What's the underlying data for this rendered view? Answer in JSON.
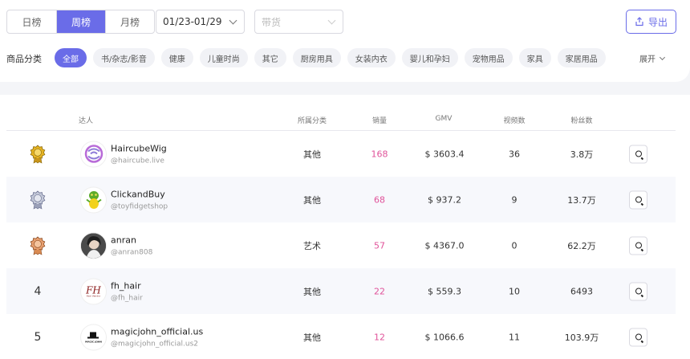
{
  "ranking_tabs": [
    {
      "label": "日榜",
      "active": false
    },
    {
      "label": "周榜",
      "active": true
    },
    {
      "label": "月榜",
      "active": false
    }
  ],
  "date_select": {
    "value": "01/23-01/29"
  },
  "type_select": {
    "placeholder": "带货"
  },
  "export": {
    "label": "导出"
  },
  "category": {
    "label": "商品分类",
    "chips": [
      "全部",
      "书/杂志/影音",
      "健康",
      "儿童时尚",
      "其它",
      "厨房用具",
      "女装内衣",
      "婴儿和孕妇",
      "宠物用品",
      "家具",
      "家居用品"
    ],
    "active": 0,
    "expand_label": "展开"
  },
  "table": {
    "headers": {
      "creator": "达人",
      "category": "所属分类",
      "sales": "销量",
      "gmv": "GMV",
      "videos": "视频数",
      "followers": "粉丝数"
    },
    "rows": [
      {
        "rank": "1",
        "name": "HaircubeWig",
        "handle": "@haircube.live",
        "category": "其他",
        "sales": "168",
        "gmv": "$ 3603.4",
        "videos": "36",
        "followers": "3.8万",
        "avatar": "haircube-logo"
      },
      {
        "rank": "2",
        "name": "ClickandBuy",
        "handle": "@toyfidgetshop",
        "category": "其他",
        "sales": "68",
        "gmv": "$ 937.2",
        "videos": "9",
        "followers": "13.7万",
        "avatar": "grinch-figure"
      },
      {
        "rank": "3",
        "name": "anran",
        "handle": "@anran808",
        "category": "艺术",
        "sales": "57",
        "gmv": "$ 4367.0",
        "videos": "0",
        "followers": "62.2万",
        "avatar": "person-photo"
      },
      {
        "rank": "4",
        "name": "fh_hair",
        "handle": "@fh_hair",
        "category": "其他",
        "sales": "22",
        "gmv": "$ 559.3",
        "videos": "10",
        "followers": "6493",
        "avatar": "fh-hair-logo",
        "avatar_text": "FH",
        "avatar_caption": "Hair Vendor"
      },
      {
        "rank": "5",
        "name": "magicjohn_official.us",
        "handle": "@magicjohn_official.us2",
        "category": "其他",
        "sales": "12",
        "gmv": "$ 1066.6",
        "videos": "11",
        "followers": "103.9万",
        "avatar": "magic-john-logo",
        "avatar_caption": "MAGIC JOHN"
      }
    ]
  },
  "colors": {
    "accent": "#6a6ce8",
    "sales": "#e0539a",
    "gold": "#e6b422",
    "silver": "#9aa0b8",
    "bronze": "#d98a52"
  }
}
